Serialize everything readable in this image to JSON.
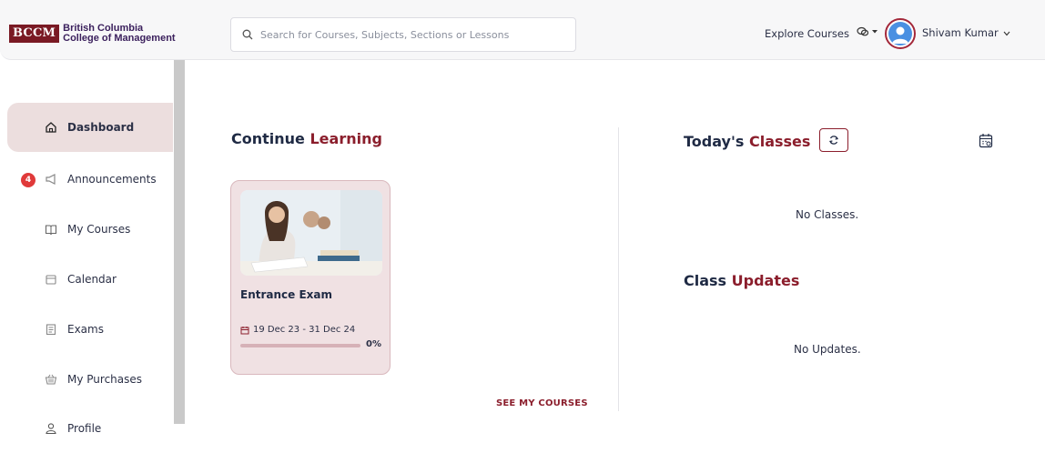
{
  "header": {
    "logo_mark": "BCCM",
    "logo_line1": "British Columbia",
    "logo_line2": "College of Management",
    "search_placeholder": "Search for Courses, Subjects, Sections or Lessons",
    "explore_label": "Explore Courses",
    "user_name": "Shivam Kumar"
  },
  "sidebar": {
    "items": [
      {
        "label": "Dashboard",
        "icon": "home-icon",
        "active": true
      },
      {
        "label": "Announcements",
        "icon": "megaphone-icon",
        "badge": "4"
      },
      {
        "label": "My Courses",
        "icon": "book-icon"
      },
      {
        "label": "Calendar",
        "icon": "calendar-icon"
      },
      {
        "label": "Exams",
        "icon": "exam-icon"
      },
      {
        "label": "My Purchases",
        "icon": "basket-icon"
      },
      {
        "label": "Profile",
        "icon": "user-icon"
      }
    ]
  },
  "continue": {
    "title_a": "Continue",
    "title_b": "Learning",
    "course": {
      "name": "Entrance Exam",
      "dates": "19 Dec 23 - 31 Dec 24",
      "progress_text": "0%",
      "progress": 0
    },
    "see_more": "SEE MY COURSES"
  },
  "classes": {
    "title_a": "Today's",
    "title_b": "Classes",
    "empty": "No Classes."
  },
  "updates": {
    "title_a": "Class",
    "title_b": "Updates",
    "empty": "No Updates."
  },
  "colors": {
    "accent": "#8b1e2c",
    "active_bg": "#ecdede",
    "badge": "#e03a3a",
    "card_bg": "#f0e1e3"
  }
}
